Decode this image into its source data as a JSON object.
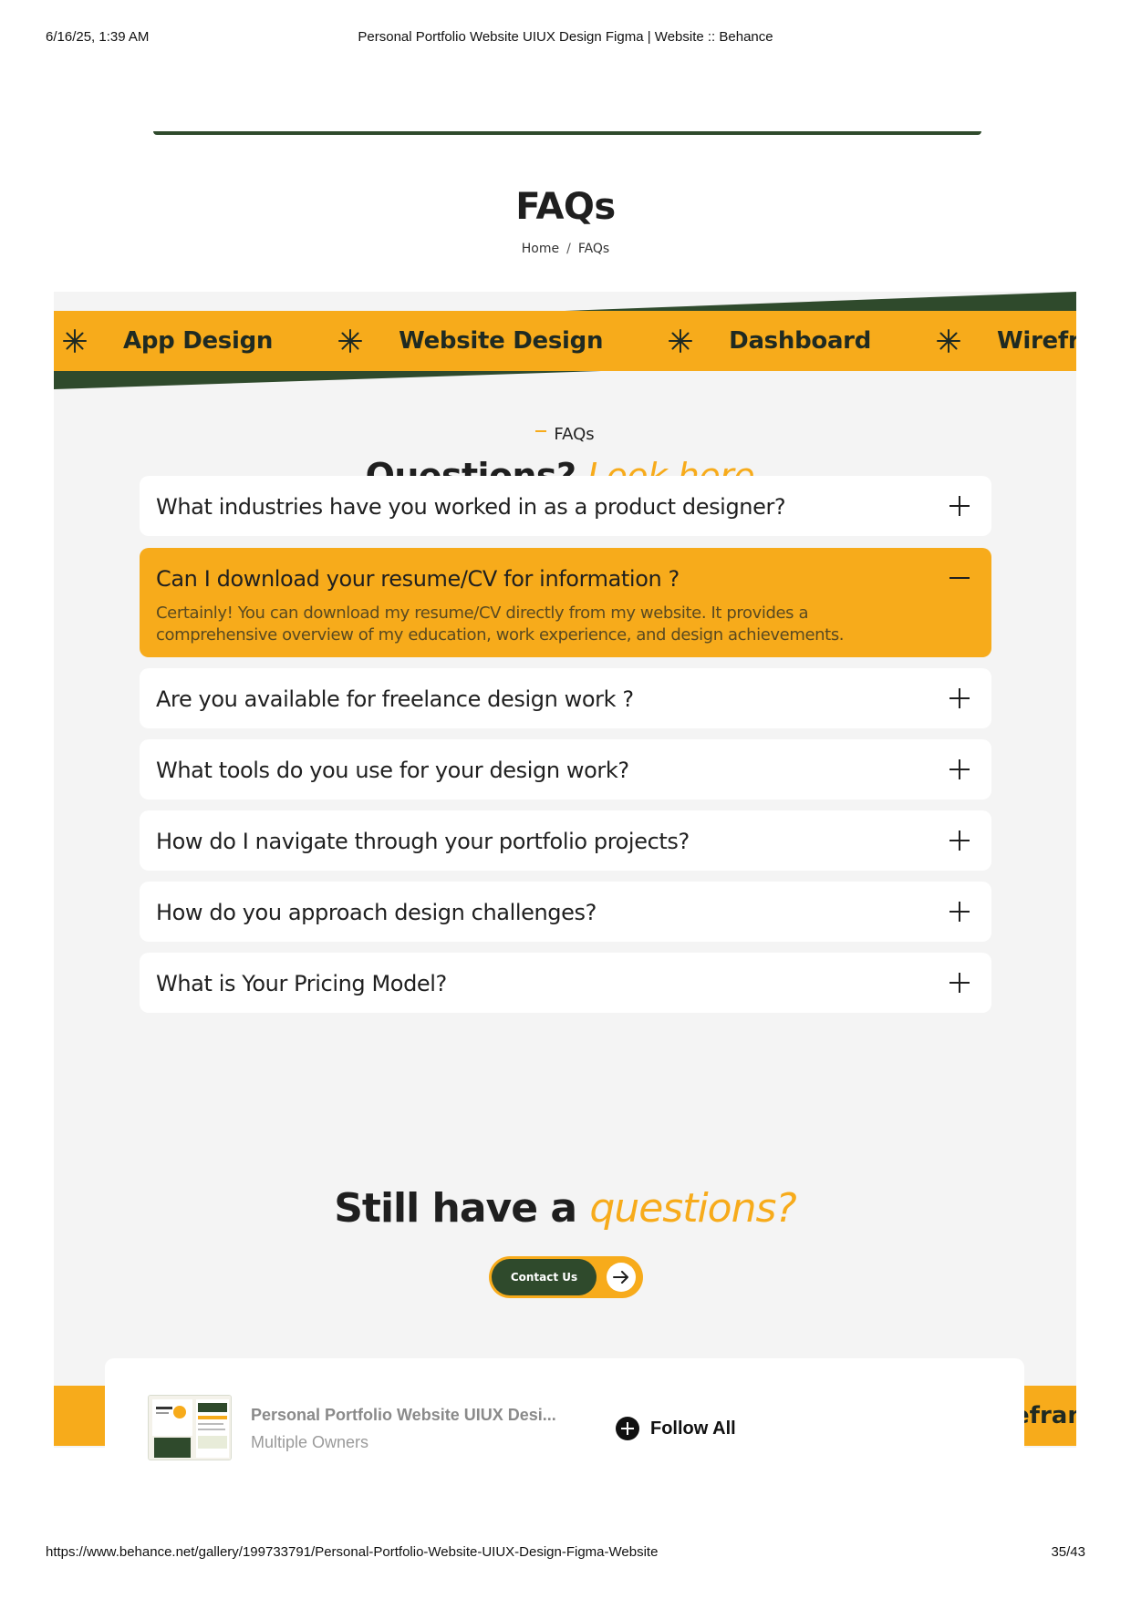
{
  "print_header": {
    "datetime": "6/16/25, 1:39 AM",
    "title": "Personal Portfolio Website UIUX Design Figma | Website :: Behance"
  },
  "print_footer": {
    "url": "https://www.behance.net/gallery/199733791/Personal-Portfolio-Website-UIUX-Design-Figma-Website",
    "page": "35/43"
  },
  "hero": {
    "title": "FAQs",
    "breadcrumb": [
      "Home",
      "FAQs"
    ]
  },
  "marquee": {
    "items": [
      "App Design",
      "Website Design",
      "Dashboard",
      "Wirefr"
    ],
    "icon": "asterisk-icon"
  },
  "faq_section": {
    "eyebrow": "FAQs",
    "title_main": "Questions?",
    "title_accent": "Look here.",
    "items": [
      {
        "question": "What industries have you worked in as a product designer?",
        "open": false
      },
      {
        "question": "Can I download your resume/CV for information ?",
        "open": true,
        "answer": "Certainly! You can download my resume/CV directly from my website. It provides a comprehensive overview of my education, work experience, and design achievements."
      },
      {
        "question": "Are you available for freelance design work ?",
        "open": false
      },
      {
        "question": "What tools do you use for your design work?",
        "open": false
      },
      {
        "question": " How do I navigate through your portfolio projects?",
        "open": false
      },
      {
        "question": "How do you approach design challenges?",
        "open": false
      },
      {
        "question": "What is Your Pricing Model?",
        "open": false
      }
    ]
  },
  "still": {
    "title_main": "Still have a",
    "title_accent": "questions?",
    "contact_label": "Contact Us"
  },
  "bottom_band_text": "efram",
  "owner_card": {
    "title": "Personal Portfolio Website UIUX Desi...",
    "subtitle": "Multiple Owners",
    "follow_label": "Follow All"
  },
  "colors": {
    "accent": "#f7ab1b",
    "dark_green": "#2f4a2c",
    "panel_bg": "#f4f4f4"
  }
}
